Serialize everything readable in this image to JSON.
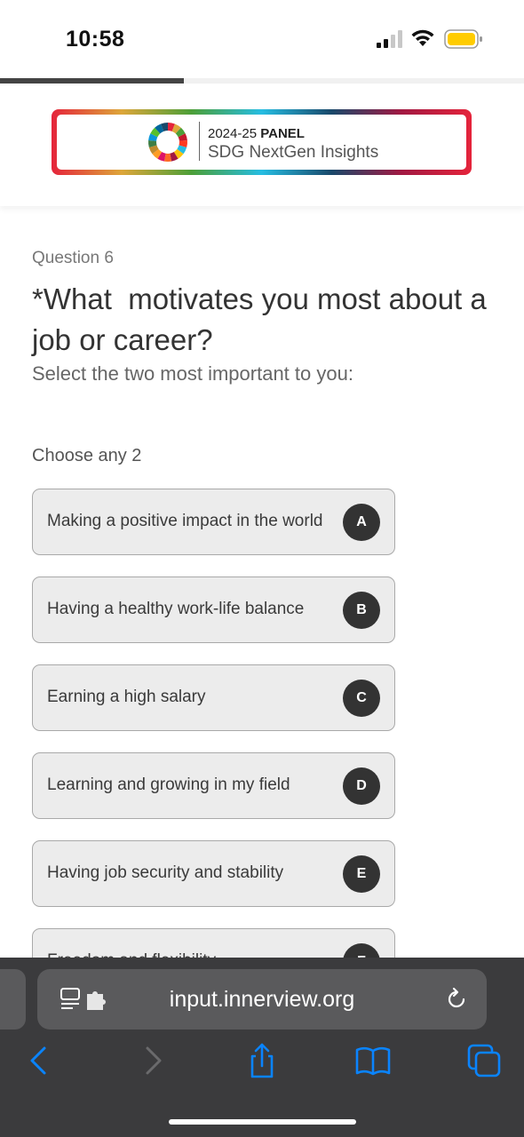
{
  "status_bar": {
    "time": "10:58"
  },
  "progress": {
    "fraction": 0.35
  },
  "banner": {
    "panel_year": "2024-25",
    "panel_label": "PANEL",
    "subtitle": "SDG NextGen Insights"
  },
  "question": {
    "number": "Question 6",
    "title": "*What  motivates you most about a job or career?",
    "subtitle": "Select the two most important to you:",
    "instruction": "Choose any 2"
  },
  "options": [
    {
      "label": "Making a positive impact in the world",
      "key": "A"
    },
    {
      "label": "Having a healthy work-life balance",
      "key": "B"
    },
    {
      "label": "Earning a high salary",
      "key": "C"
    },
    {
      "label": "Learning and growing in my field",
      "key": "D"
    },
    {
      "label": "Having job security and stability",
      "key": "E"
    },
    {
      "label": "Freedom and flexibility",
      "key": "F"
    }
  ],
  "browser": {
    "url": "input.innerview.org",
    "icons": {
      "reader": "reader-mode-extensions-icon",
      "reload": "reload-icon",
      "back": "back-chevron-icon",
      "forward": "forward-chevron-icon",
      "share": "share-icon",
      "bookmarks": "bookmarks-book-icon",
      "tabs": "tabs-icon"
    }
  },
  "colors": {
    "accent_dark": "#333333",
    "option_bg": "#ececec",
    "browser_bg": "#3b3b3d",
    "ios_blue": "#0a84ff"
  }
}
